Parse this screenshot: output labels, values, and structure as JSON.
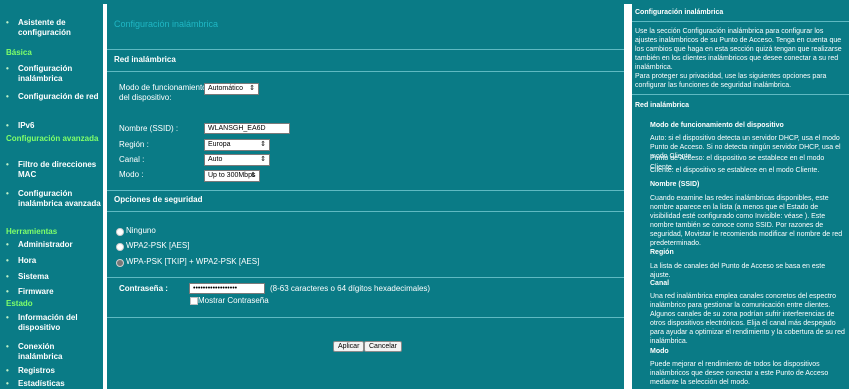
{
  "sidebar": {
    "items": [
      {
        "label": "Asistente de configuración"
      },
      {
        "label": "Básica",
        "section": true
      },
      {
        "label": "Configuración inalámbrica"
      },
      {
        "label": "Configuración de red"
      },
      {
        "label": "IPv6"
      },
      {
        "label": "Configuración avanzada",
        "section": true
      },
      {
        "label": "Filtro de direcciones MAC"
      },
      {
        "label": "Configuración inalámbrica avanzada"
      },
      {
        "label": "Herramientas",
        "section": true
      },
      {
        "label": "Administrador"
      },
      {
        "label": "Hora"
      },
      {
        "label": "Sistema"
      },
      {
        "label": "Firmware"
      },
      {
        "label": "Estado",
        "section": true
      },
      {
        "label": "Información del dispositivo"
      },
      {
        "label": "Conexión inalámbrica"
      },
      {
        "label": "Registros"
      },
      {
        "label": "Estadísticas"
      }
    ]
  },
  "main": {
    "page_title": "Configuración inalámbrica",
    "wireless_section": {
      "heading": "Red inalámbrica",
      "mode_label": "Modo de funcionamiento del dispositivo:",
      "mode_value": "Automático",
      "ssid_label": "Nombre (SSID) :",
      "ssid_value": "WLANSGH_EA6D",
      "region_label": "Región :",
      "region_value": "Europa",
      "channel_label": "Canal :",
      "channel_value": "Auto",
      "modo_label": "Modo :",
      "modo_value": "Up to 300Mbps"
    },
    "security_section": {
      "heading": "Opciones de seguridad",
      "options": [
        {
          "label": "Ninguno",
          "checked": false
        },
        {
          "label": "WPA2-PSK [AES]",
          "checked": false
        },
        {
          "label": "WPA-PSK [TKIP] + WPA2-PSK [AES]",
          "checked": true
        }
      ],
      "password_label": "Contraseña :",
      "password_value": "••••••••••••••••••",
      "password_hint": "(8-63 caracteres o 64 dígitos hexadecimales)",
      "show_password_label": "Mostrar Contraseña"
    },
    "buttons": {
      "apply": "Aplicar",
      "cancel": "Cancelar"
    }
  },
  "help": {
    "title": "Configuración inalámbrica",
    "intro": "Use la sección Configuración inalámbrica para configurar los ajustes inalámbricos de su Punto de Acceso. Tenga en cuenta que los cambios que haga en esta sección quizá tengan que realizarse también en los clientes inalámbricos que desee conectar a su red inalámbrica.",
    "protect": "Para proteger su privacidad, use las siguientes opciones para configurar las funciones de seguridad inalámbrica.",
    "red_heading": "Red inalámbrica",
    "mode_heading": "Modo de funcionamiento del dispositivo",
    "mode_p1": "Auto: si el dispositivo detecta un servidor DHCP, usa el modo Punto de Acceso. Si no detecta ningún servidor DHCP, usa el modo Cliente.",
    "mode_p2": "Punto de Acceso: el dispositivo se establece en el modo Cliente.",
    "mode_p3": "Cliente: el dispositivo se establece en el modo Cliente.",
    "ssid_heading": "Nombre (SSID)",
    "ssid_p": "Cuando examine las redes inalámbricas disponibles, este nombre aparece en la lista (a menos que el Estado de visibilidad esté configurado como Invisible: véase ). Este nombre también se conoce como SSID. Por razones de seguridad, Movistar le recomienda modificar el nombre de red predeterminado.",
    "region_heading": "Región",
    "region_p": "La lista de canales del Punto de Acceso se basa en este ajuste.",
    "canal_heading": "Canal",
    "canal_p": "Una red inalámbrica emplea canales concretos del espectro inalámbrico para gestionar la comunicación entre clientes. Algunos canales de su zona podrían sufrir interferencias de otros dispositivos electrónicos. Elija el canal más despejado para ayudar a optimizar el rendimiento y la cobertura de su red inalámbrica.",
    "modo_heading": "Modo",
    "modo_p": "Puede mejorar el rendimiento de todos los dispositivos inalámbricos que desee conectar a este Punto de Acceso mediante la selección del modo."
  }
}
